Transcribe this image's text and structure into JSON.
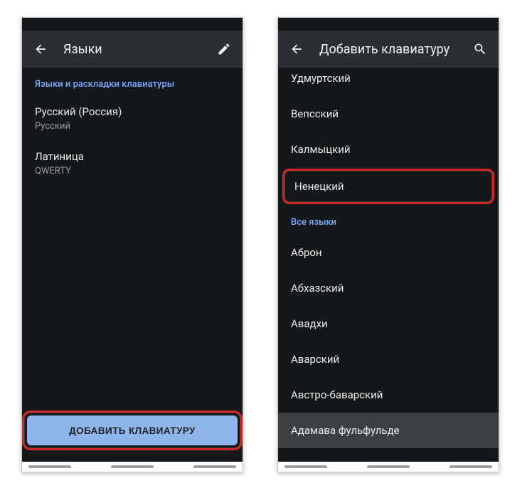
{
  "left": {
    "title": "Языки",
    "section_header": "Языки и раскладки клавиатуры",
    "items": [
      {
        "primary": "Русский (Россия)",
        "secondary": "Русский"
      },
      {
        "primary": "Латиница",
        "secondary": "QWERTY"
      }
    ],
    "add_button": "ДОБАВИТЬ КЛАВИАТУРУ"
  },
  "right": {
    "title": "Добавить клавиатуру",
    "suggested_truncated_first": "Удмуртский",
    "suggested": [
      "Вепсский",
      "Калмыцкий",
      "Ненецкий"
    ],
    "all_header": "Все языки",
    "all": [
      "Аброн",
      "Абхазский",
      "Авадхи",
      "Аварский",
      "Австро-баварский",
      "Адамава фульфульде"
    ]
  }
}
